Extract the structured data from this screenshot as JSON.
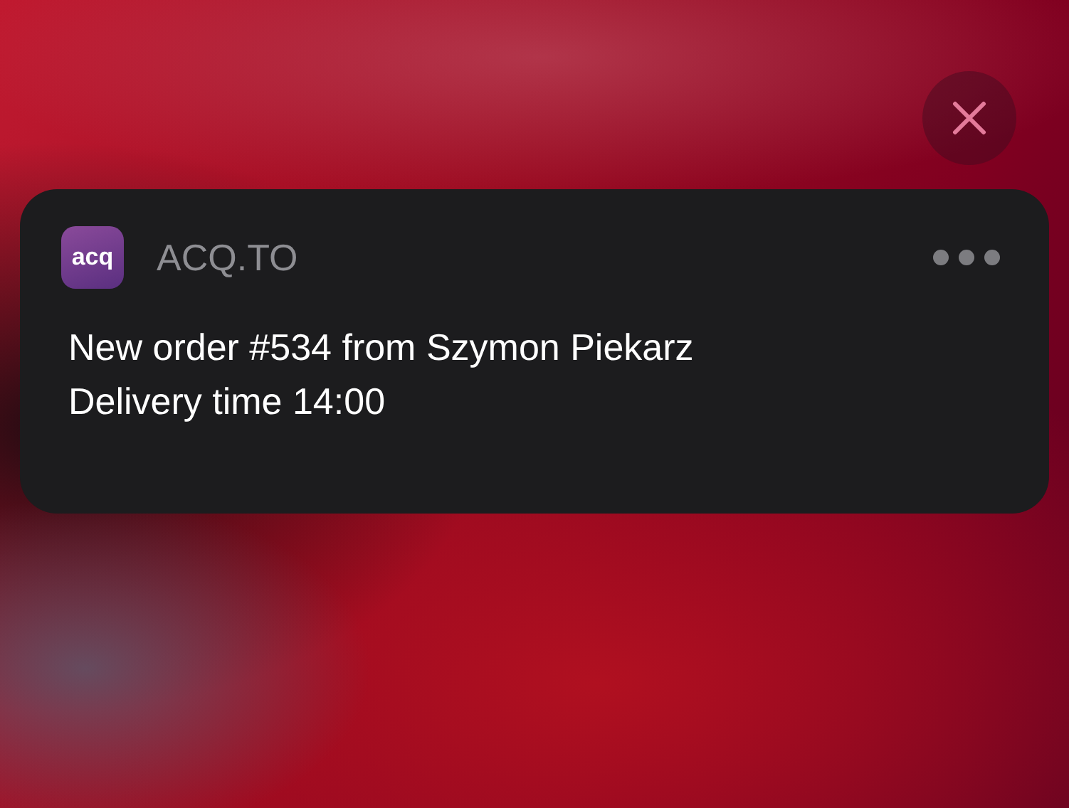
{
  "notification": {
    "app_icon_text": "acq",
    "app_name": "ACQ.TO",
    "lines": [
      "New order #534 from Szymon Piekarz",
      "Delivery time 14:00"
    ]
  }
}
